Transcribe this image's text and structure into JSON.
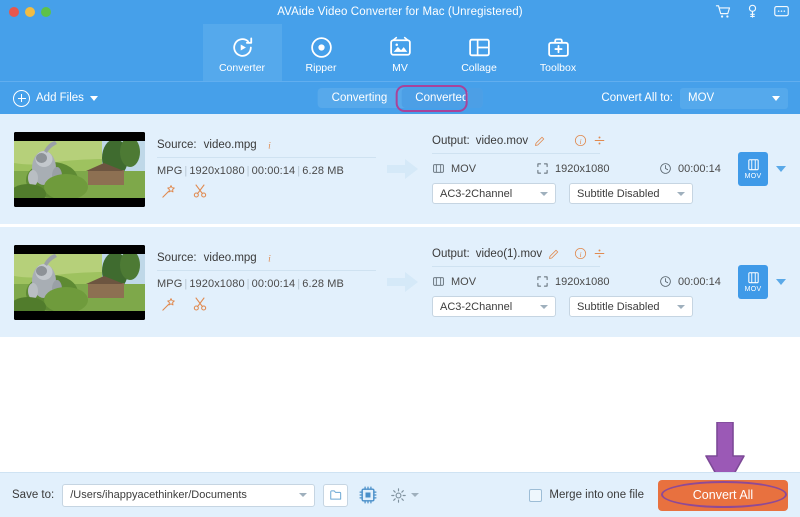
{
  "window": {
    "title": "AVAide Video Converter for Mac (Unregistered)",
    "traffic_lights": [
      "close",
      "minimize",
      "zoom"
    ],
    "right_icons": [
      "cart-icon",
      "key-icon",
      "feedback-icon"
    ],
    "accent_blue": "#46a0ea",
    "accent_orange": "#e8713f",
    "annotation_purple": "#8e4a96"
  },
  "nav": {
    "tabs": [
      {
        "label": "Converter",
        "icon": "converter-icon",
        "active": true
      },
      {
        "label": "Ripper",
        "icon": "ripper-icon",
        "active": false
      },
      {
        "label": "MV",
        "icon": "mv-icon",
        "active": false
      },
      {
        "label": "Collage",
        "icon": "collage-icon",
        "active": false
      },
      {
        "label": "Toolbox",
        "icon": "toolbox-icon",
        "active": false
      }
    ]
  },
  "toolbar": {
    "add_files_label": "Add Files",
    "add_files_icon": "plus-circle-icon",
    "status_tabs": [
      {
        "label": "Converting",
        "selected": false
      },
      {
        "label": "Converted",
        "selected": true,
        "annotated": true
      }
    ],
    "convert_all_to_label": "Convert All to:",
    "convert_all_to_value": "MOV"
  },
  "files": [
    {
      "thumbnail": "video-thumbnail",
      "source_label": "Source:",
      "source_name": "video.mpg",
      "info_icon": "info-icon",
      "format": "MPG",
      "resolution": "1920x1080",
      "duration": "00:00:14",
      "size": "6.28 MB",
      "edit_icon": "magic-wand-edit-icon",
      "trim_icon": "scissors-trim-icon",
      "edit_tools_annotated": true,
      "output_label": "Output:",
      "output_name": "video.mov",
      "rename_icon": "pencil-rename-icon",
      "out_info_icon": "info-icon",
      "split_icon": "split-icon",
      "out_format_icon": "film-icon",
      "out_format": "MOV",
      "out_resolution_icon": "resize-icon",
      "out_resolution": "1920x1080",
      "out_duration_icon": "clock-icon",
      "out_duration": "00:00:14",
      "audio_track": "AC3-2Channel",
      "subtitle_track": "Subtitle Disabled",
      "format_badge": "MOV"
    },
    {
      "thumbnail": "video-thumbnail",
      "source_label": "Source:",
      "source_name": "video.mpg",
      "info_icon": "info-icon",
      "format": "MPG",
      "resolution": "1920x1080",
      "duration": "00:00:14",
      "size": "6.28 MB",
      "edit_icon": "magic-wand-edit-icon",
      "trim_icon": "scissors-trim-icon",
      "edit_tools_annotated": false,
      "output_label": "Output:",
      "output_name": "video(1).mov",
      "rename_icon": "pencil-rename-icon",
      "out_info_icon": "info-icon",
      "split_icon": "split-icon",
      "out_format_icon": "film-icon",
      "out_format": "MOV",
      "out_resolution_icon": "resize-icon",
      "out_resolution": "1920x1080",
      "out_duration_icon": "clock-icon",
      "out_duration": "00:00:14",
      "audio_track": "AC3-2Channel",
      "subtitle_track": "Subtitle Disabled",
      "format_badge": "MOV"
    }
  ],
  "bottom": {
    "save_to_label": "Save to:",
    "save_to_path": "/Users/ihappyacethinker/Documents",
    "folder_icon": "folder-open-icon",
    "gpu_icon": "gpu-acceleration-icon",
    "settings_icon": "gear-settings-icon",
    "merge_label": "Merge into one file",
    "merge_checked": false,
    "convert_button_label": "Convert All",
    "convert_button_annotated": true
  }
}
